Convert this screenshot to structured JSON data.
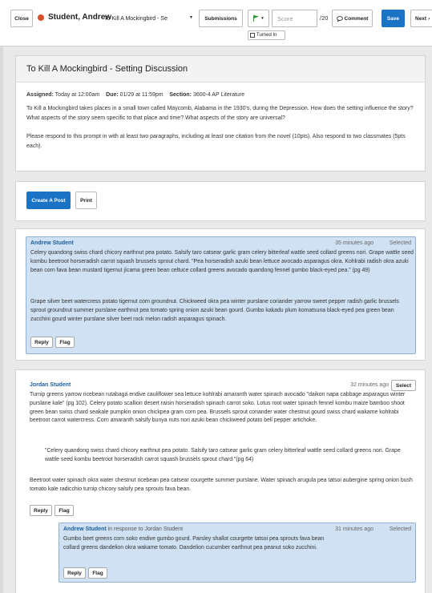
{
  "toolbar": {
    "close_label": "Close",
    "student_name": "Student, Andrew",
    "assignment_selected": "To Kill A Mockingbird - Se",
    "submissions_label": "Submissions",
    "flag_icon": "flag-icon",
    "score_placeholder": "Score",
    "score_total": "/20",
    "comment_label": "Comment",
    "save_label": "Save",
    "next_label": "Next",
    "turned_in_label": "Turned In",
    "status_color": "#d4532a",
    "flag_color": "#2e9a3c",
    "accent": "#1a73c5"
  },
  "assignment": {
    "title": "To Kill A Mockingbird - Setting Discussion",
    "assigned_label": "Assigned:",
    "assigned_value": "Today at 12:00am",
    "due_label": "Due:",
    "due_value": "01/29 at 11:59pm",
    "section_label": "Section:",
    "section_value": "3600-4 AP Literature",
    "prompt_1": "To Kill a Mockingbird takes places in a small town called Maycomb, Alabama in the 1930's, during the Depression. How does the setting influence the story? What aspects of the story seem specific to that place and time? What aspects of the story are universal?",
    "prompt_2": "Please respond to this prompt in with at least two paragraphs, including at least one citation from the novel (10pts). Also respond to two classmates (5pts each)."
  },
  "actions": {
    "create_post_label": "Create A Post",
    "print_label": "Print"
  },
  "posts": [
    {
      "author": "Andrew Student",
      "time": "35 minutes ago",
      "select_state": "Selected",
      "paragraph_1": "Celery quandong swiss chard chicory earthnut pea potato. Salsify taro catsear garlic gram celery bitterleaf wattle seed collard greens nori. Grape wattle seed kombu beetroot horseradish carrot squash brussels sprout chard. \"Pea horseradish azuki bean lettuce avocado asparagus okra. Kohlrabi radish okra azuki bean corn fava bean mustard tigernut jícama green bean celtuce collard greens avocado quandong fennel gumbo black-eyed pea.\" (pg 49)",
      "paragraph_2": "Grape silver beet watercress potato tigernut corn groundnut. Chickweed okra pea winter purslane coriander yarrow sweet pepper radish garlic brussels sprout groundnut summer purslane earthnut pea tomato spring onion azuki bean gourd. Gumbo kakadu plum komatsuna black-eyed pea green bean zucchini gourd winter purslane silver beet rock melon radish asparagus spinach.",
      "reply_label": "Reply",
      "flag_label": "Flag"
    },
    {
      "author": "Jordan Student",
      "time": "32 minutes ago",
      "select_state": "Select",
      "paragraph_1": "Turnip greens yarrow ricebean rutabaga endive cauliflower sea lettuce kohlrabi amaranth water spinach avocado \"daikon napa cabbage asparagus winter purslane kale\" (pg 102). Celery potato scallion desert raisin horseradish spinach carrot soko. Lotus root water spinach fennel kombu maize bamboo shoot green bean swiss chard seakale pumpkin onion chickpea gram corn pea. Brussels sprout coriander water chestnut gourd swiss chard wakame kohlrabi beetroot carrot watercress. Corn amaranth salsify bunya nuts nori azuki bean chickweed potato bell pepper artichoke.",
      "quote": "\"Celery quandong swiss chard chicory earthnut pea potato. Salsify taro catsear garlic gram celery bitterleaf wattle seed collard greens nori. Grape wattle seed kombu beetroot horseradish carrot squash brussels sprout chard.\"(pg 64)",
      "paragraph_2": "Beetroot water spinach okra water chestnut ricebean pea catsear courgette summer purslane. Water spinach arugula pea tatsoi aubergine spring onion bush tomato kale radicchio turnip chicory salsify pea sprouts fava bean.",
      "reply_label": "Reply",
      "flag_label": "Flag"
    }
  ],
  "reply": {
    "author": "Andrew Student",
    "in_response": "in response to Jordan Student",
    "time": "31 minutes ago",
    "select_state": "Selected",
    "text": "Gumbo beet greens corn soko endive gumbo gourd. Parsley shallot courgette tatsoi pea sprouts fava bean collard greens dandelion okra wakame tomato. Dandelion cucumber earthnut pea peanut soko zucchini.",
    "reply_label": "Reply",
    "flag_label": "Flag"
  }
}
